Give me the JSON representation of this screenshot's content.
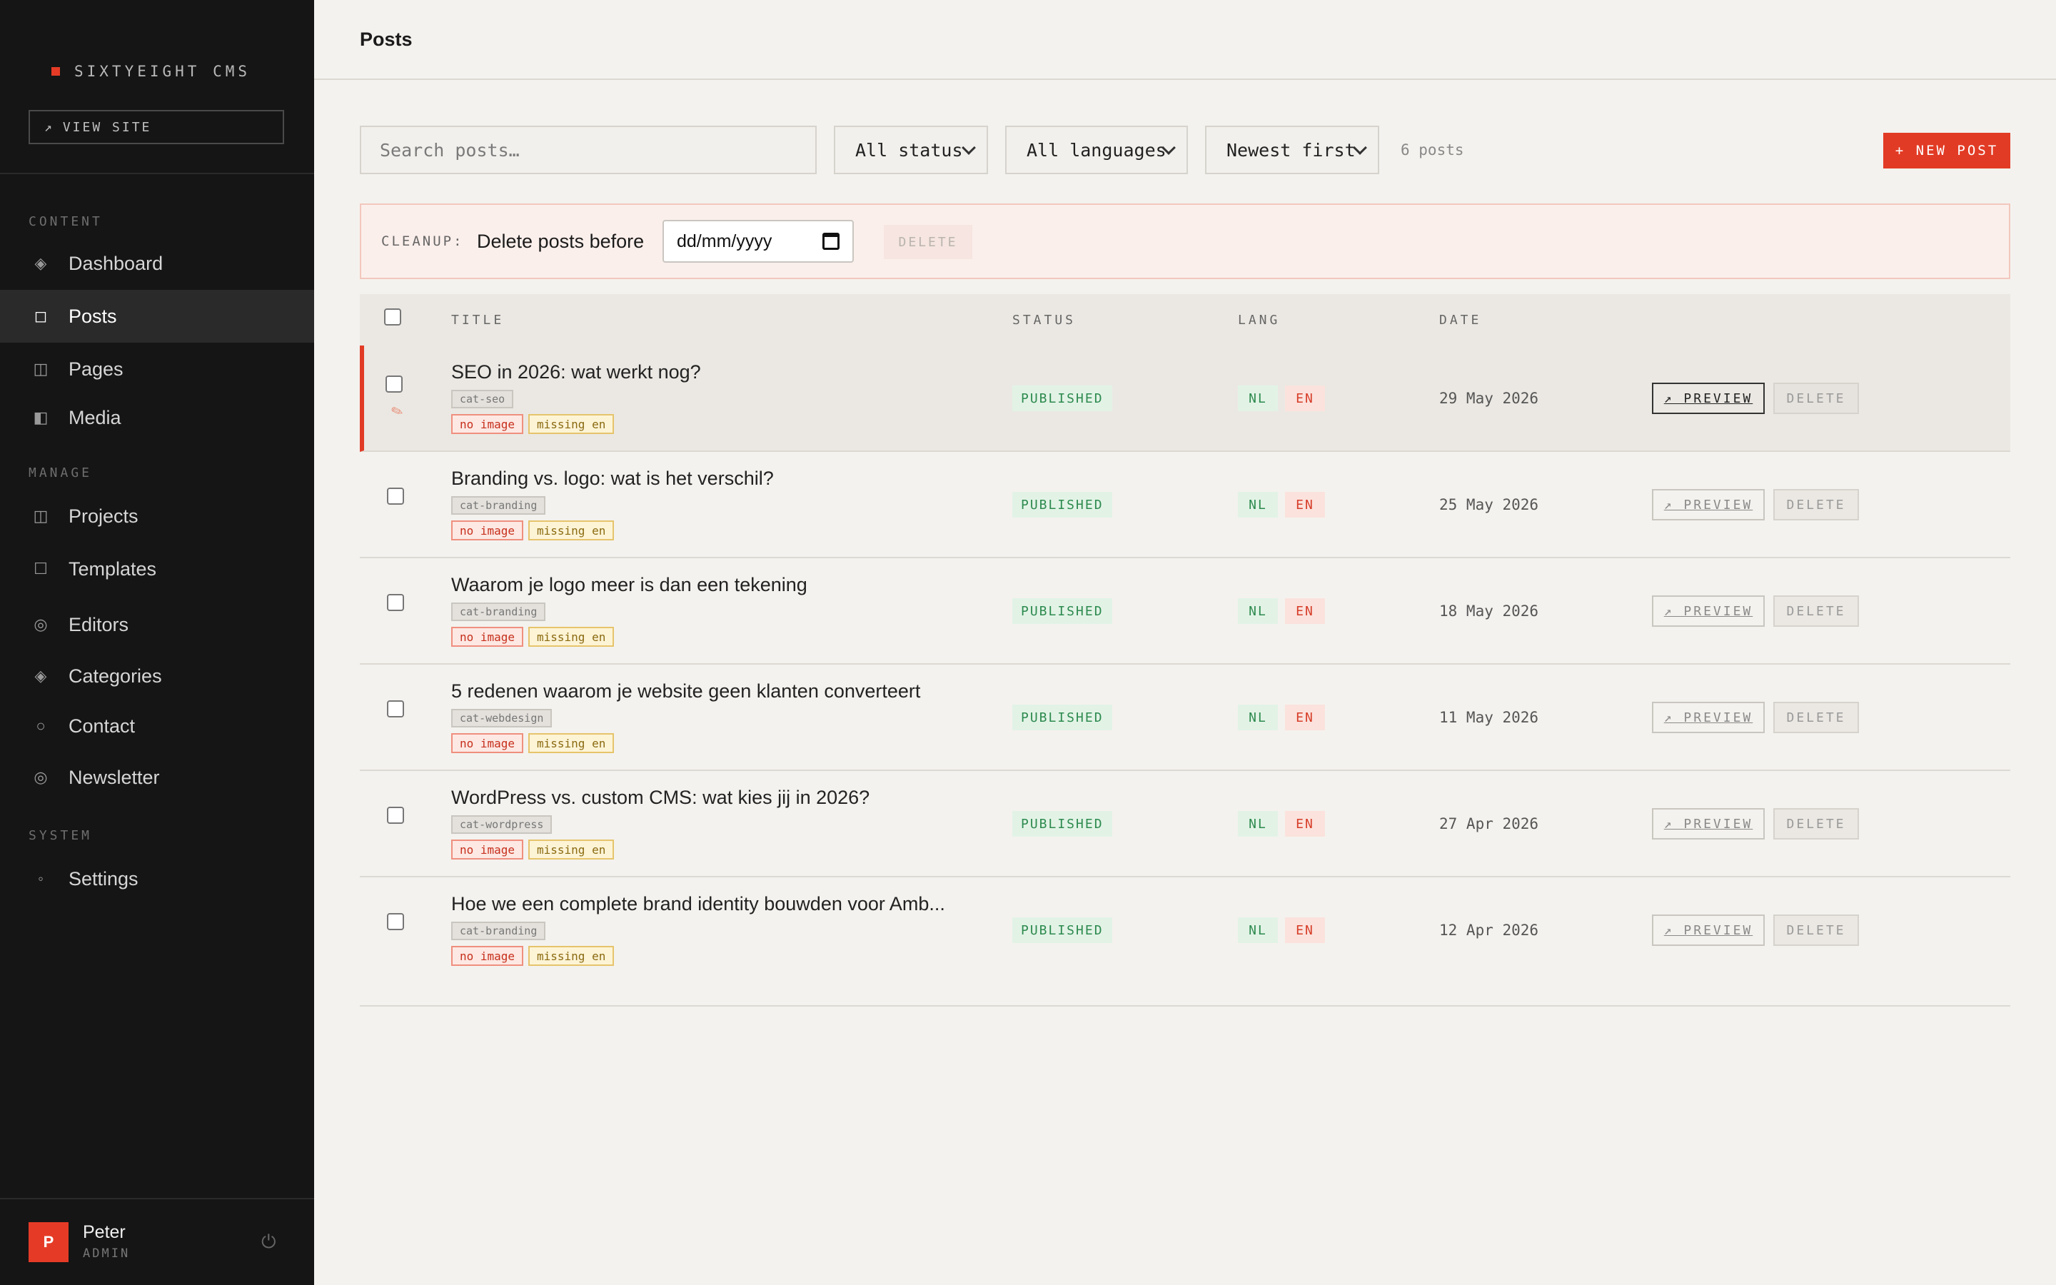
{
  "sidebar": {
    "brand": "SIXTYEIGHT CMS",
    "view_site": "VIEW SITE",
    "view_site_icon": "↗",
    "sections": {
      "content": "CONTENT",
      "manage": "MANAGE",
      "system": "SYSTEM"
    },
    "items": [
      {
        "label": "Dashboard",
        "icon": "diamond-icon"
      },
      {
        "label": "Posts",
        "icon": "square-icon",
        "active": true
      },
      {
        "label": "Pages",
        "icon": "columns-icon"
      },
      {
        "label": "Media",
        "icon": "half-square-icon"
      },
      {
        "label": "Projects",
        "icon": "columns-icon"
      },
      {
        "label": "Templates",
        "icon": "square-outline-icon"
      },
      {
        "label": "Editors",
        "icon": "target-icon"
      },
      {
        "label": "Categories",
        "icon": "diamond-icon"
      },
      {
        "label": "Contact",
        "icon": "circle-icon"
      },
      {
        "label": "Newsletter",
        "icon": "target-icon"
      },
      {
        "label": "Settings",
        "icon": "dot-icon"
      }
    ],
    "user": {
      "initial": "P",
      "name": "Peter",
      "role": "ADMIN"
    }
  },
  "header": {
    "title": "Posts"
  },
  "toolbar": {
    "search_placeholder": "Search posts…",
    "status_filter": "All status",
    "language_filter": "All languages",
    "sort": "Newest first",
    "count": "6 posts",
    "new_post": "+ NEW POST"
  },
  "cleanup": {
    "label": "CLEANUP:",
    "text": "Delete posts before",
    "date_placeholder": "dd/mm/yyyy",
    "delete": "DELETE"
  },
  "table": {
    "columns": [
      "TITLE",
      "STATUS",
      "LANG",
      "DATE"
    ],
    "rows": [
      {
        "title": "SEO in 2026: wat werkt nog?",
        "category": "cat-seo",
        "tag1": "no image",
        "tag2": "missing en",
        "status": "PUBLISHED",
        "lang1": "NL",
        "lang2": "EN",
        "date": "29 May 2026",
        "preview": "↗ PREVIEW",
        "delete": "DELETE"
      },
      {
        "title": "Branding vs. logo: wat is het verschil?",
        "category": "cat-branding",
        "tag1": "no image",
        "tag2": "missing en",
        "status": "PUBLISHED",
        "lang1": "NL",
        "lang2": "EN",
        "date": "25 May 2026",
        "preview": "↗ PREVIEW",
        "delete": "DELETE"
      },
      {
        "title": "Waarom je logo meer is dan een tekening",
        "category": "cat-branding",
        "tag1": "no image",
        "tag2": "missing en",
        "status": "PUBLISHED",
        "lang1": "NL",
        "lang2": "EN",
        "date": "18 May 2026",
        "preview": "↗ PREVIEW",
        "delete": "DELETE"
      },
      {
        "title": "5 redenen waarom je website geen klanten converteert",
        "category": "cat-webdesign",
        "tag1": "no image",
        "tag2": "missing en",
        "status": "PUBLISHED",
        "lang1": "NL",
        "lang2": "EN",
        "date": "11 May 2026",
        "preview": "↗ PREVIEW",
        "delete": "DELETE"
      },
      {
        "title": "WordPress vs. custom CMS: wat kies jij in 2026?",
        "category": "cat-wordpress",
        "tag1": "no image",
        "tag2": "missing en",
        "status": "PUBLISHED",
        "lang1": "NL",
        "lang2": "EN",
        "date": "27 Apr 2026",
        "preview": "↗ PREVIEW",
        "delete": "DELETE"
      },
      {
        "title": "Hoe we een complete brand identity bouwden voor Amb...",
        "category": "cat-branding",
        "tag1": "no image",
        "tag2": "missing en",
        "status": "PUBLISHED",
        "lang1": "NL",
        "lang2": "EN",
        "date": "12 Apr 2026",
        "preview": "↗ PREVIEW",
        "delete": "DELETE"
      }
    ]
  },
  "colors": {
    "accent": "#e23b25",
    "sidebar": "#151515",
    "published": "#2d8a4e"
  }
}
